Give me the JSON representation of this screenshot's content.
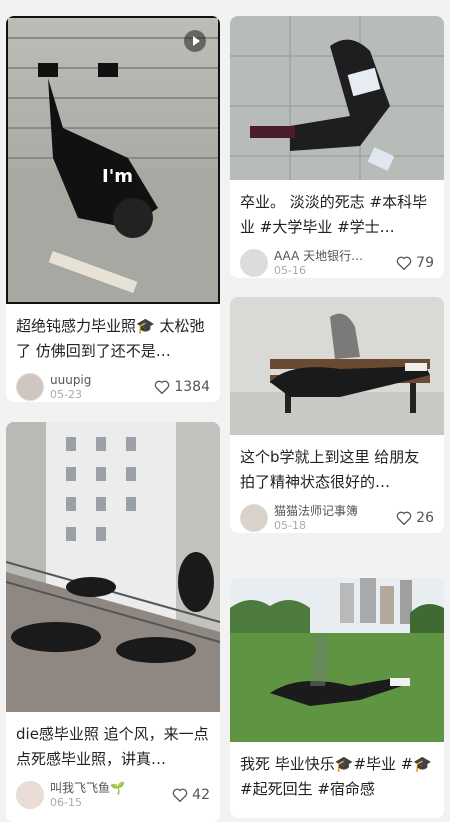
{
  "feed": {
    "left": [
      {
        "title": "超绝钝感力毕业照🎓 太松弛了 仿佛回到了还不是…",
        "author": "uuupig",
        "date": "05-23",
        "likes": "1384",
        "overlay": "I'm",
        "is_video": true
      },
      {
        "title": "die感毕业照 追个风，来一点点死感毕业照，讲真…",
        "author": "叫我飞飞鱼🌱",
        "date": "06-15",
        "likes": "42"
      }
    ],
    "right": [
      {
        "title": "卒业。 淡淡的死志 #本科毕业 #大学毕业 #学士…",
        "author": "AAA 天地银行…",
        "date": "05-16",
        "likes": "79"
      },
      {
        "title": "这个b学就上到这里 给朋友拍了精神状态很好的…",
        "author": "猫猫法师记事簿",
        "date": "05-18",
        "likes": "26"
      },
      {
        "title": "我死 毕业快乐🎓#毕业 #🎓 #起死回生 #宿命感",
        "author": "",
        "date": "",
        "likes": ""
      }
    ]
  },
  "icons": {
    "like": "heart-outline-icon",
    "video": "play-icon"
  },
  "colors": {
    "background": "#f2f2f2",
    "card": "#ffffff",
    "text": "#222222",
    "meta": "#aaaaaa"
  }
}
